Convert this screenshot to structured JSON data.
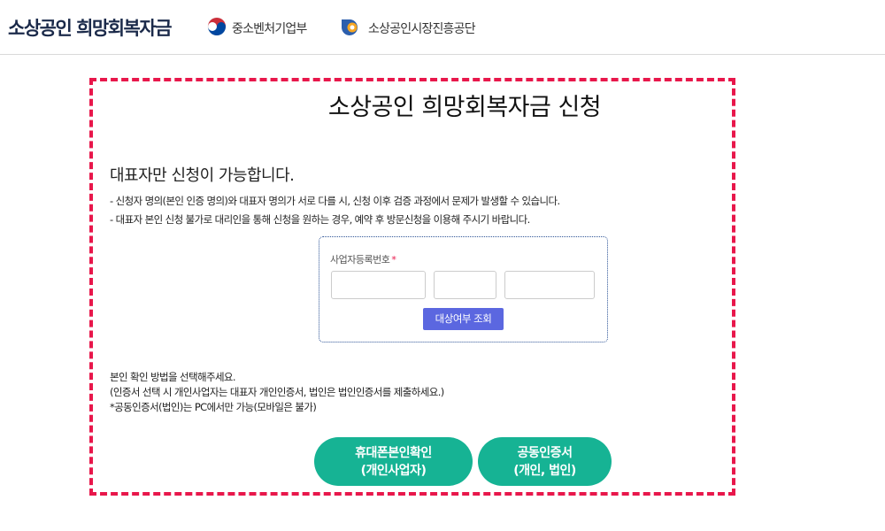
{
  "header": {
    "brand": "소상공인 희망회복자금",
    "ministry_name": "중소벤처기업부",
    "agency_name": "소상공인시장진흥공단",
    "icons": [
      "taegeuk-emblem-icon",
      "agency-logo-icon"
    ]
  },
  "main": {
    "title": "소상공인 희망회복자금 신청",
    "notice": {
      "heading": "대표자만 신청이 가능합니다.",
      "lines": [
        "- 신청자 명의(본인 인증 명의)와 대표자 명의가 서로 다를 시, 신청 이후 검증 과정에서 문제가 발생할 수 있습니다.",
        "- 대표자 본인 신청 불가로 대리인을 통해 신청을 원하는 경우, 예약 후 방문신청을 이용해 주시기 바랍니다."
      ]
    },
    "lookup": {
      "label": "사업자등록번호",
      "required_mark": "*",
      "inputs": [
        {
          "value": "",
          "placeholder": ""
        },
        {
          "value": "",
          "placeholder": ""
        },
        {
          "value": "",
          "placeholder": ""
        }
      ],
      "button_label": "대상여부 조회"
    },
    "method": {
      "lines": [
        "본인 확인 방법을 선택해주세요.",
        "(인증서 선택 시 개인사업자는 대표자 개인인증서, 법인은 법인인증서를 제출하세요.)",
        "*공동인증서(법인)는 PC에서만 가능(모바일은 불가)"
      ]
    },
    "auth_buttons": [
      {
        "line1": "휴대폰본인확인",
        "line2": "(개인사업자)"
      },
      {
        "line1": "공동인증서",
        "line2": "(개인, 법인)"
      }
    ]
  },
  "colors": {
    "highlight_border": "#e8174b",
    "auth_button": "#16b394",
    "lookup_button": "#5b67e0",
    "brand_text": "#1b2a4a"
  }
}
